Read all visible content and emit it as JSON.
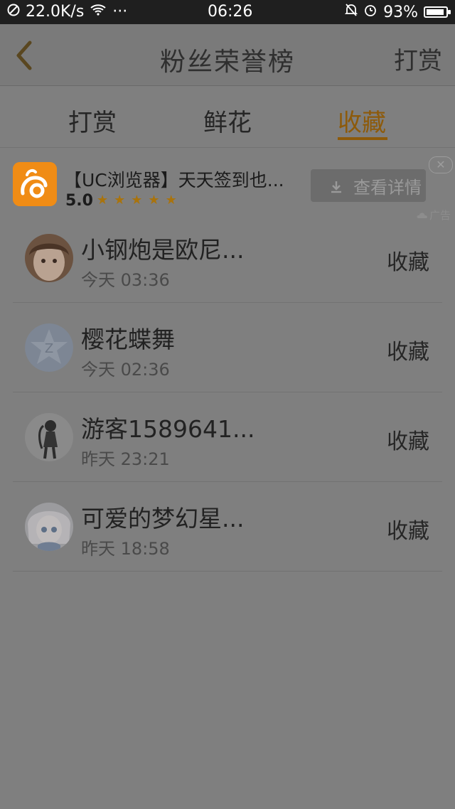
{
  "statusbar": {
    "speed": "22.0K/s",
    "dots": "···",
    "time": "06:26",
    "battery": "93%"
  },
  "header": {
    "title": "粉丝荣誉榜",
    "right_action": "打赏"
  },
  "tabs": [
    {
      "label": "打赏"
    },
    {
      "label": "鲜花"
    },
    {
      "label": "收藏"
    }
  ],
  "active_tab": "收藏",
  "ad": {
    "title": "【UC浏览器】天天签到也...",
    "rating": "5.0",
    "stars": 5,
    "button": "查看详情",
    "close": "✕",
    "label": "广告"
  },
  "list": [
    {
      "name": "小钢炮是欧尼...",
      "time": "今天 03:36",
      "action": "收藏"
    },
    {
      "name": "樱花蝶舞",
      "time": "今天 02:36",
      "action": "收藏"
    },
    {
      "name": "游客1589641...",
      "time": "昨天 23:21",
      "action": "收藏"
    },
    {
      "name": "可爱的梦幻星...",
      "time": "昨天 18:58",
      "action": "收藏"
    }
  ],
  "colors": {
    "accent": "#8d5a0a",
    "overlay": "#7f7f7f"
  }
}
